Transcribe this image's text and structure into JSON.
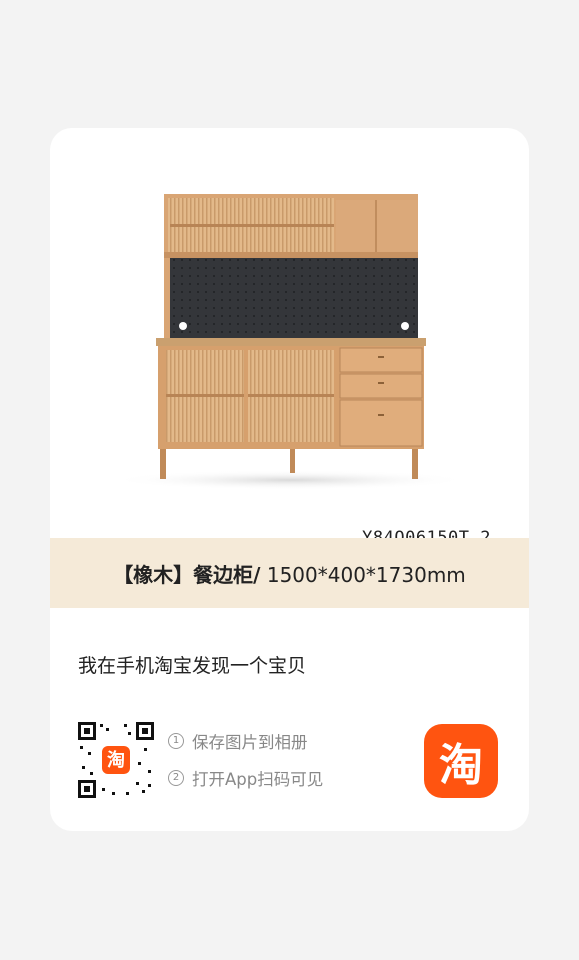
{
  "product": {
    "sku": "Y84Q06150T_2",
    "title_bold": "【橡木】餐边柜/",
    "title_rest": " 1500*400*1730mm",
    "image_alt": "oak sideboard cabinet"
  },
  "share": {
    "text": "我在手机淘宝发现一个宝贝"
  },
  "steps": [
    {
      "num": "1",
      "label": "保存图片到相册"
    },
    {
      "num": "2",
      "label": "打开App扫码可见"
    }
  ],
  "qr": {
    "logo_char": "淘"
  },
  "brand": {
    "logo_char": "淘",
    "color": "#ff5410"
  },
  "colors": {
    "band": "#f5ead8",
    "background": "#f3f3f3"
  }
}
